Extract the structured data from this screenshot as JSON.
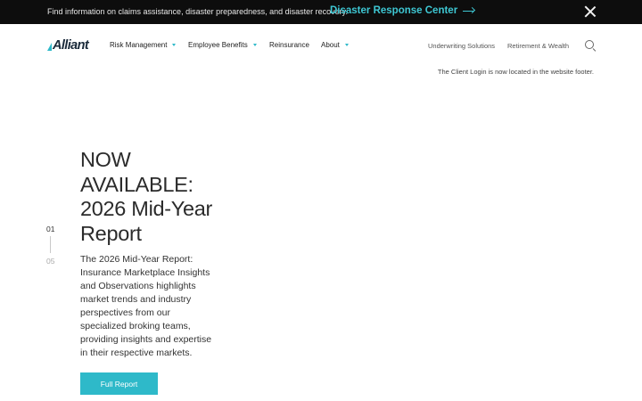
{
  "announcement": {
    "text": "Find information on claims assistance, disaster preparedness, and disaster recovery.",
    "link_label": "Disaster Response Center"
  },
  "header": {
    "logo_text": "Alliant",
    "nav": [
      {
        "label": "Risk Management",
        "has_dropdown": true
      },
      {
        "label": "Employee Benefits",
        "has_dropdown": true
      },
      {
        "label": "Reinsurance",
        "has_dropdown": false
      },
      {
        "label": "About",
        "has_dropdown": true
      }
    ],
    "utility_links": [
      "Underwriting Solutions",
      "Retirement & Wealth"
    ],
    "login_note": "The Client Login is now located in the website footer."
  },
  "hero": {
    "slide_current": "01",
    "slide_total": "05",
    "title": "NOW AVAILABLE: 2026 Mid-Year Report",
    "description": "The 2026 Mid-Year Report: Insurance Marketplace Insights and Observations highlights market trends and industry perspectives from our specialized broking teams, providing insights and expertise in their respective markets.",
    "cta_label": "Full Report"
  },
  "colors": {
    "accent": "#2eb9c9",
    "topbar_bg": "#0d0d0d",
    "topbar_link": "#3ec7d3"
  },
  "icons": [
    "close-icon",
    "arrow-right-icon",
    "search-icon",
    "logo-mark",
    "chevron-down-icon"
  ]
}
